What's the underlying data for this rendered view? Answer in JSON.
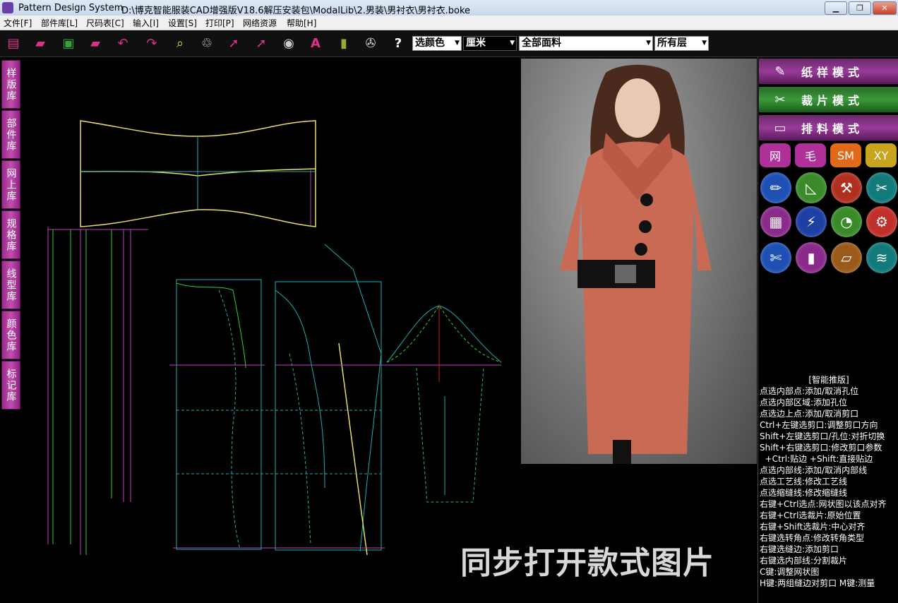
{
  "window": {
    "app_name": "Pattern Design System",
    "path": "D:\\博克智能服装CAD增强版V18.6解压安装包\\ModalLib\\2.男装\\男衬衣\\男衬衣.boke",
    "min_icon": "▁",
    "max_icon": "❐",
    "close_icon": "✕"
  },
  "menu": [
    {
      "label": "文件[F]"
    },
    {
      "label": "部件库[L]"
    },
    {
      "label": "尺码表[C]"
    },
    {
      "label": "输入[I]"
    },
    {
      "label": "设置[S]"
    },
    {
      "label": "打印[P]"
    },
    {
      "label": "网络资源"
    },
    {
      "label": "帮助[H]"
    }
  ],
  "toolbar": {
    "tools": [
      {
        "name": "new-file-icon",
        "glyph": "▤"
      },
      {
        "name": "open-folder-icon",
        "glyph": "▰"
      },
      {
        "name": "save-icon",
        "glyph": "▣"
      },
      {
        "name": "save-as-folder-icon",
        "glyph": "▰"
      },
      {
        "name": "undo-icon",
        "glyph": "↶"
      },
      {
        "name": "redo-icon",
        "glyph": "↷"
      },
      {
        "name": "zoom-icon",
        "glyph": "⌕"
      },
      {
        "name": "delete-bin-icon",
        "glyph": "♲"
      },
      {
        "name": "select-arrow-icon",
        "glyph": "➚"
      },
      {
        "name": "select-arrow-alt-icon",
        "glyph": "➚"
      },
      {
        "name": "tape-measure-icon",
        "glyph": "◉"
      },
      {
        "name": "text-icon",
        "glyph": "A"
      },
      {
        "name": "ruler-icon",
        "glyph": "▮"
      },
      {
        "name": "film-reel-icon",
        "glyph": "✇"
      },
      {
        "name": "help-icon",
        "glyph": "?"
      }
    ],
    "combo_color": "选颜色",
    "combo_unit": "厘米",
    "combo_fabric": "全部面料",
    "combo_layer": "所有层",
    "dropdown_icon": "▼"
  },
  "left_tabs": [
    {
      "label": "样版库"
    },
    {
      "label": "部件库"
    },
    {
      "label": "网上库"
    },
    {
      "label": "规格库"
    },
    {
      "label": "线型库"
    },
    {
      "label": "颜色库"
    },
    {
      "label": "标记库"
    }
  ],
  "overlay_text": "同步打开款式图片",
  "right_panel": {
    "modes": [
      {
        "label": "纸样模式",
        "icon": "✎"
      },
      {
        "label": "裁片模式",
        "icon": "✂"
      },
      {
        "label": "排料模式",
        "icon": "▭"
      }
    ],
    "pills": [
      {
        "label": "网",
        "color": "#b0309a"
      },
      {
        "label": "毛",
        "color": "#b0309a"
      },
      {
        "label": "SM",
        "color": "#e06a1a"
      },
      {
        "label": "XY",
        "color": "#c9a41f"
      }
    ],
    "tools": [
      {
        "name": "pencil-icon",
        "glyph": "✏",
        "color": "#1e4fb3"
      },
      {
        "name": "set-square-icon",
        "glyph": "◺",
        "color": "#3a8a2a"
      },
      {
        "name": "compass-icon",
        "glyph": "⚒",
        "color": "#b03020"
      },
      {
        "name": "scissors-icon",
        "glyph": "✂",
        "color": "#127a7a"
      },
      {
        "name": "notebook-icon",
        "glyph": "▦",
        "color": "#8a2a8a"
      },
      {
        "name": "brush-icon",
        "glyph": "⚡",
        "color": "#1e3fa3"
      },
      {
        "name": "tape-icon",
        "glyph": "◔",
        "color": "#3a8a2a"
      },
      {
        "name": "sewing-machine-icon",
        "glyph": "⚙",
        "color": "#c0302a"
      },
      {
        "name": "cutter-icon",
        "glyph": "✄",
        "color": "#1e4fb3"
      },
      {
        "name": "book-icon",
        "glyph": "▮",
        "color": "#8a2a8a"
      },
      {
        "name": "ruler-icon",
        "glyph": "▱",
        "color": "#9a5a1a"
      },
      {
        "name": "rainbow-icon",
        "glyph": "≋",
        "color": "#127a7a"
      }
    ],
    "help_title": "[智能推版]",
    "help_lines": [
      "点选内部点:添加/取消孔位",
      "点选内部区域:添加孔位",
      "点选边上点:添加/取消剪口",
      "Ctrl+左键选剪口:调整剪口方向",
      "Shift+左键选剪口/孔位:对折切换",
      "Shift+右键选剪口:修改剪口参数",
      "  +Ctrl:贴边 +Shift:直接贴边",
      "点选内部线:添加/取消内部线",
      "点选工艺线:修改工艺线",
      "点选缩缝线:修改缩缝线",
      "右键+Ctrl选点:网状图以该点对齐",
      "右键+Ctrl选裁片:原始位置",
      "右键+Shift选裁片:中心对齐",
      "右键选转角点:修改转角类型",
      "右键选缝边:添加剪口",
      "右键选内部线:分割裁片",
      "C键:调整网状图",
      "H键:两组缝边对剪口  M键:测量"
    ]
  }
}
